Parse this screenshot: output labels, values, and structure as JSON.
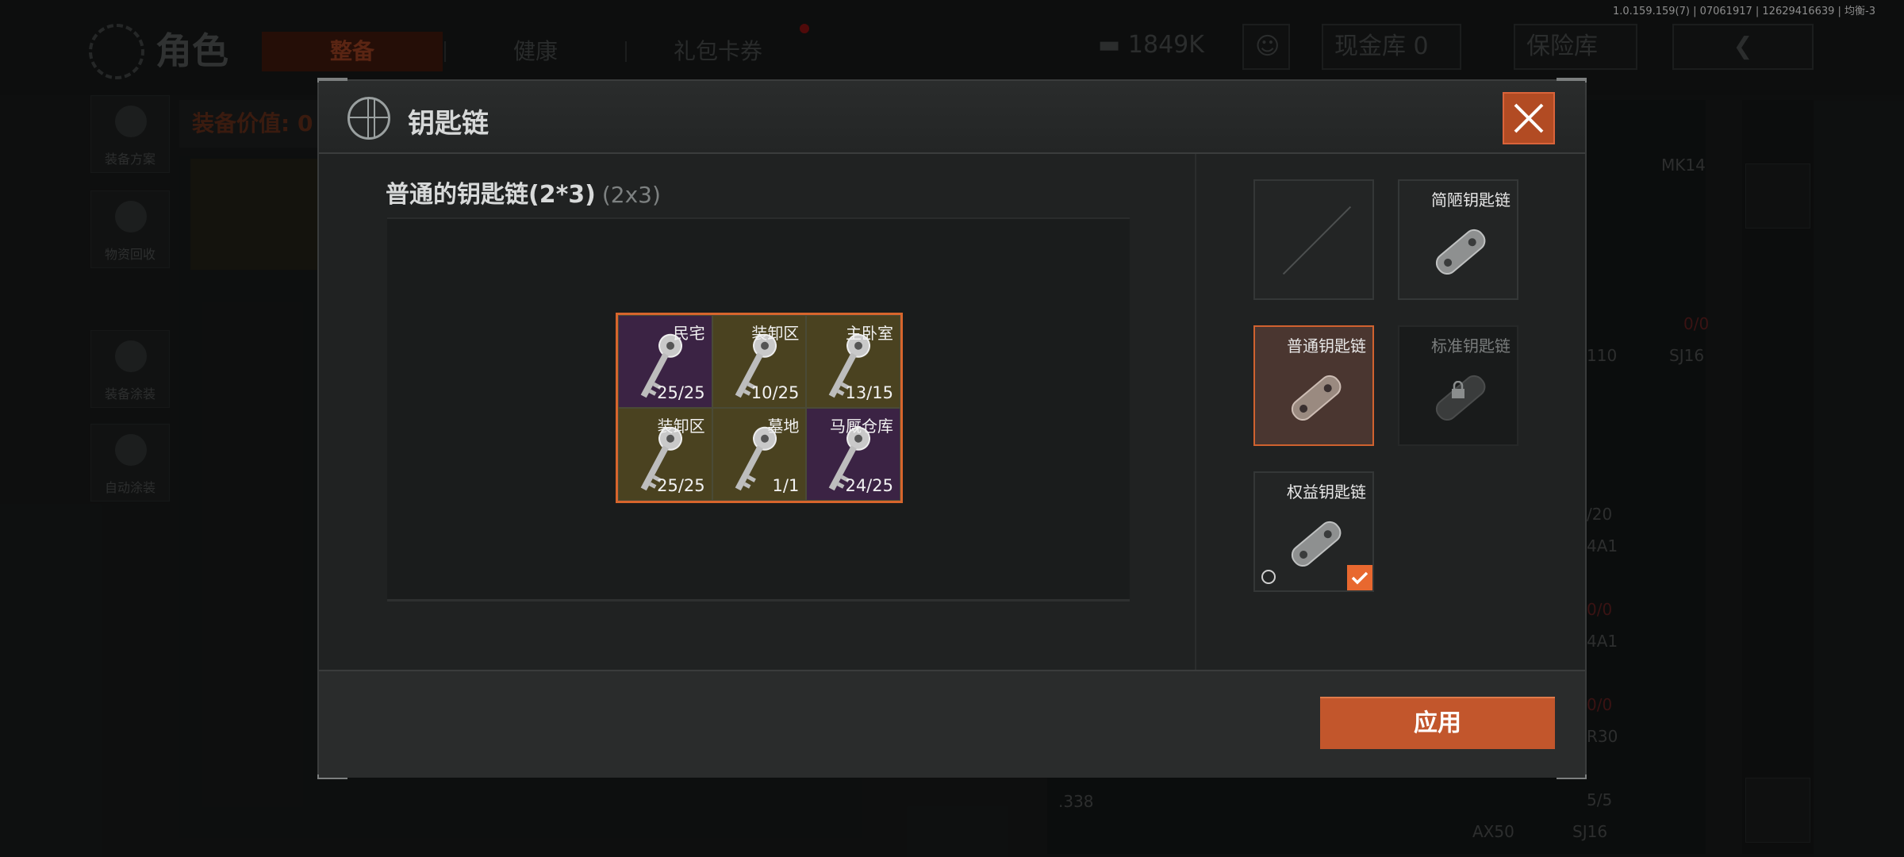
{
  "version_text": "1.0.159.159(7) | 07061917 | 12629416639 | 均衡-3",
  "background": {
    "role_title": "角色",
    "tabs": [
      "整备",
      "健康",
      "礼包卡券"
    ],
    "money": "1849K",
    "vault": "现金库 0",
    "safe": "保险库",
    "value_label": "装备价值: 0",
    "side_buttons": [
      "装备方案",
      "物资回收",
      "装备涂装",
      "自动涂装"
    ],
    "right_texts": [
      "MK14",
      "0/0",
      "SJ16",
      "/20",
      "0/0",
      "0/0",
      ".338",
      "5/5",
      "AX50",
      "SJ16",
      "110",
      "4A1",
      "4A1",
      "R30"
    ]
  },
  "modal": {
    "title": "钥匙链",
    "close_icon": "close-icon",
    "keychain_name": "普通的钥匙链(2*3)",
    "keychain_size": "(2x3)",
    "apply_label": "应用",
    "keys": [
      {
        "name": "民宅",
        "count": "25/25",
        "color": "purple"
      },
      {
        "name": "装卸区",
        "count": "10/25",
        "color": "olive"
      },
      {
        "name": "主卧室",
        "count": "13/15",
        "color": "olive"
      },
      {
        "name": "装卸区",
        "count": "25/25",
        "color": "olive"
      },
      {
        "name": "墓地",
        "count": "1/1",
        "color": "olive"
      },
      {
        "name": "马厩仓库",
        "count": "24/25",
        "color": "purple"
      }
    ],
    "chains": [
      {
        "label": "",
        "state": "empty"
      },
      {
        "label": "简陋钥匙链",
        "state": "normal"
      },
      {
        "label": "普通钥匙链",
        "state": "selected"
      },
      {
        "label": "标准钥匙链",
        "state": "locked"
      },
      {
        "label": "权益钥匙链",
        "state": "owned"
      }
    ]
  },
  "colors": {
    "accent": "#c2562c",
    "purple_rarity": "#3b2344",
    "olive_rarity": "#4a4220"
  }
}
